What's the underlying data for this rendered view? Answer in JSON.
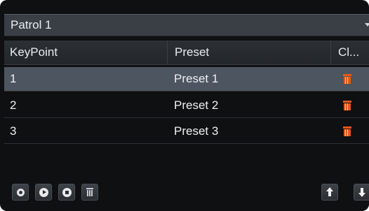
{
  "patrol": {
    "selected": "Patrol 1"
  },
  "table": {
    "columns": [
      "KeyPoint",
      "Preset",
      "Cl..."
    ],
    "rows": [
      {
        "keypoint": "1",
        "preset": "Preset 1",
        "clear_icon": "trash-icon"
      },
      {
        "keypoint": "2",
        "preset": "Preset 2",
        "clear_icon": "trash-icon"
      },
      {
        "keypoint": "3",
        "preset": "Preset 3",
        "clear_icon": "trash-icon"
      }
    ],
    "selected_row": 0
  },
  "toolbar": {
    "buttons": [
      "set-icon",
      "play-icon",
      "stop-icon",
      "delete-icon",
      "move-up-icon",
      "move-down-icon"
    ]
  },
  "colors": {
    "background": "#0f1012",
    "selected_row": "#4c5560",
    "delete_accent": "#e4571c"
  }
}
